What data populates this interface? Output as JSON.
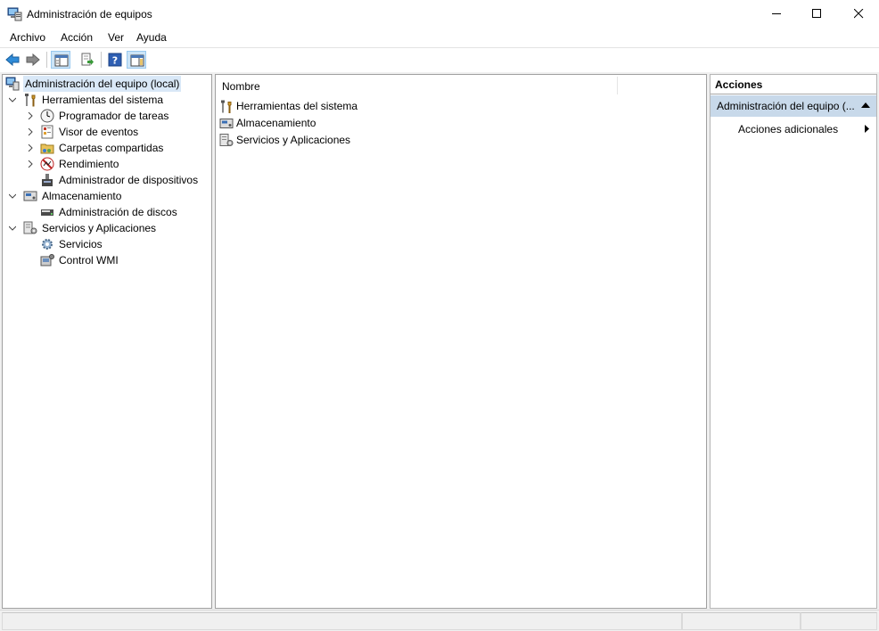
{
  "window": {
    "title": "Administración de equipos"
  },
  "menu": [
    {
      "label": "Archivo"
    },
    {
      "label": "Acción"
    },
    {
      "label": "Ver"
    },
    {
      "label": "Ayuda"
    }
  ],
  "toolbar": {
    "buttons": [
      {
        "icon": "back-arrow-icon"
      },
      {
        "icon": "forward-arrow-icon"
      },
      {
        "icon": "show-hide-console-tree-icon"
      },
      {
        "icon": "export-list-icon"
      },
      {
        "icon": "help-icon"
      },
      {
        "icon": "show-hide-action-pane-icon"
      }
    ]
  },
  "tree": {
    "root": {
      "label": "Administración del equipo (local)",
      "icon": "computer-management-icon",
      "selected": true
    },
    "items": [
      {
        "label": "Herramientas del sistema",
        "icon": "tools-icon",
        "expanded": true
      },
      {
        "label": "Programador de tareas",
        "icon": "clock-icon",
        "expandable": true
      },
      {
        "label": "Visor de eventos",
        "icon": "event-viewer-icon",
        "expandable": true
      },
      {
        "label": "Carpetas compartidas",
        "icon": "shared-folder-icon",
        "expandable": true
      },
      {
        "label": "Rendimiento",
        "icon": "performance-icon",
        "expandable": true
      },
      {
        "label": "Administrador de dispositivos",
        "icon": "device-manager-icon",
        "expandable": false
      },
      {
        "label": "Almacenamiento",
        "icon": "storage-icon",
        "expanded": true
      },
      {
        "label": "Administración de discos",
        "icon": "disk-icon",
        "expandable": false
      },
      {
        "label": "Servicios y Aplicaciones",
        "icon": "services-apps-icon",
        "expanded": true
      },
      {
        "label": "Servicios",
        "icon": "gear-icon",
        "expandable": false
      },
      {
        "label": "Control WMI",
        "icon": "wmi-icon",
        "expandable": false
      }
    ]
  },
  "list": {
    "column_header": "Nombre",
    "rows": [
      {
        "label": "Herramientas del sistema",
        "icon": "tools-icon"
      },
      {
        "label": "Almacenamiento",
        "icon": "storage-icon"
      },
      {
        "label": "Servicios y Aplicaciones",
        "icon": "services-apps-icon"
      }
    ]
  },
  "actions": {
    "header": "Acciones",
    "section": "Administración del equipo (...",
    "items": [
      {
        "label": "Acciones adicionales"
      }
    ]
  },
  "colors": {
    "selection": "#d9e8f7",
    "actions_section": "#c8d9ea",
    "toolbar_active": "#cce4f7"
  }
}
